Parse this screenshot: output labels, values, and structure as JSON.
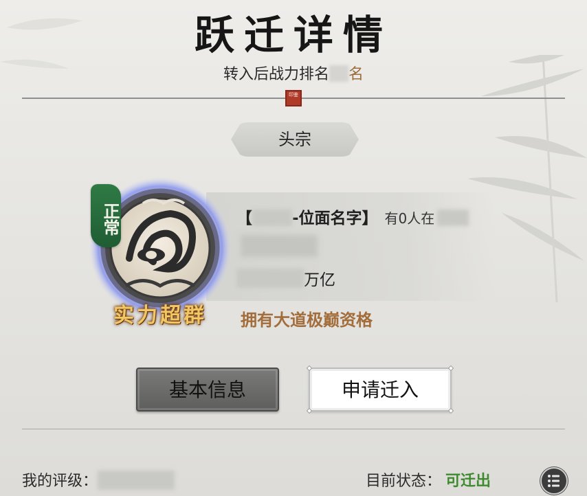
{
  "header": {
    "title": "跃迁详情",
    "subtitle_prefix": "转入后战力排名",
    "subtitle_suffix": "名",
    "seal_text": "印鉴"
  },
  "sect": {
    "rank_title": "头宗",
    "status_tag": "正常",
    "strength_label": "实力超群",
    "plane_name_suffix": "-位面名字】",
    "plane_open_bracket": "【",
    "people_text": "有0人在",
    "power_unit": "万亿",
    "qualification": "拥有大道极巅资格"
  },
  "buttons": {
    "basic_info": "基本信息",
    "apply_move": "申请迁入"
  },
  "footer": {
    "my_rating_label": "我的评级：",
    "current_status_label": "目前状态：",
    "current_status_value": "可迁出"
  },
  "colors": {
    "accent_brown": "#a26d3b",
    "status_green": "#3d8b2e",
    "gold_text": "#f1c765",
    "tag_green": "#2f7a45"
  },
  "icons": {
    "menu": "list-menu-icon",
    "emblem": "sect-emblem-icon"
  }
}
